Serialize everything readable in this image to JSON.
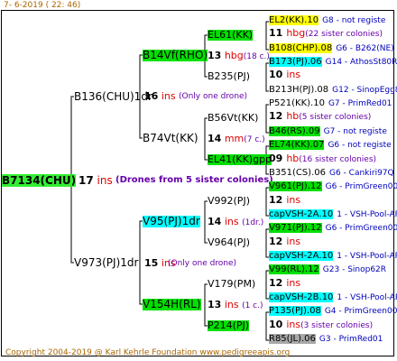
{
  "header": "7-  6-2019 ( 22: 46)",
  "footer": "Copyright 2004-2019 @ Karl Kehrle Foundation    www.pedigreeapis.org",
  "root": {
    "id": "B7134(CHU)",
    "count": "17",
    "unit": "ins",
    "note": "(Drones from 5 sister colonies)"
  },
  "p1": {
    "id": "B136(CHU)1dr",
    "count": "16",
    "unit": "ins",
    "note": "(Only one drone)"
  },
  "p2": {
    "id": "V973(PJ)1dr",
    "count": "15",
    "unit": "ins",
    "note": "(Only one drone)"
  },
  "g1": {
    "id": "B14Vf(RHO)",
    "count": "13",
    "unit": "hbg",
    "note": "(18 c.)"
  },
  "g2": {
    "id": "B74Vt(KK)",
    "count": "14",
    "unit": "mm",
    "note": "(7 c.)"
  },
  "g3": {
    "id": "V95(PJ)1dr",
    "count": "14",
    "unit": "ins",
    "note": "(1dr.)"
  },
  "g4": {
    "id": "V154H(RL)",
    "count": "13",
    "unit": "ins",
    "note": "(1 c.)"
  },
  "gg": [
    {
      "id": "EL61(KK)"
    },
    {
      "id": "B235(PJ)"
    },
    {
      "id": "B56Vt(KK)"
    },
    {
      "id": "EL41(KK)gpp"
    },
    {
      "id": "V992(PJ)"
    },
    {
      "id": "V964(PJ)"
    },
    {
      "id": "V179(PM)"
    },
    {
      "id": "P214(PJ)"
    }
  ],
  "ggg": [
    {
      "id": "EL2(KK).10",
      "desc": "G8 - not registe"
    },
    {
      "c": "11",
      "u": "hbg",
      "n": "(22 sister colonies)"
    },
    {
      "id": "B108(CHP).08",
      "desc": "G6 - B262(NE)"
    },
    {
      "id": "B173(PJ).06",
      "desc": "G14 - AthosSt80R"
    },
    {
      "c": "10",
      "u": "ins",
      "n": ""
    },
    {
      "id": "B213H(PJ).08",
      "desc": "G12 - SinopEgg86R"
    },
    {
      "id": "P521(KK).10",
      "desc": "G7 - PrimRed01"
    },
    {
      "c": "12",
      "u": "hb",
      "n": "(5 sister colonies)"
    },
    {
      "id": "B46(RS).09",
      "desc": "G7 - not registe"
    },
    {
      "id": "EL74(KK).07",
      "desc": "G6 - not registe"
    },
    {
      "c": "09",
      "u": "hb",
      "n": "(16 sister colonies)"
    },
    {
      "id": "B351(CS).06",
      "desc": "G6 - Cankiri97Q"
    },
    {
      "id": "V961(PJ).12",
      "desc": "G6 - PrimGreen00"
    },
    {
      "c": "12",
      "u": "ins",
      "n": ""
    },
    {
      "id": "capVSH-2A.10",
      "desc": "1 - VSH-Pool-AR"
    },
    {
      "id": "V971(PJ).12",
      "desc": "G6 - PrimGreen00"
    },
    {
      "c": "12",
      "u": "ins",
      "n": ""
    },
    {
      "id": "capVSH-2A.10",
      "desc": "1 - VSH-Pool-AR"
    },
    {
      "id": "V99(RL).12",
      "desc": "G23 - Sinop62R"
    },
    {
      "c": "12",
      "u": "ins",
      "n": ""
    },
    {
      "id": "capVSH-2B.10",
      "desc": "1 - VSH-Pool-AR"
    },
    {
      "id": "P135(PJ).08",
      "desc": "G4 - PrimGreen00"
    },
    {
      "c": "10",
      "u": "ins",
      "n": "(3 sister colonies)"
    },
    {
      "id": "R85(JL).06",
      "desc": "G3 - PrimRed01"
    }
  ]
}
